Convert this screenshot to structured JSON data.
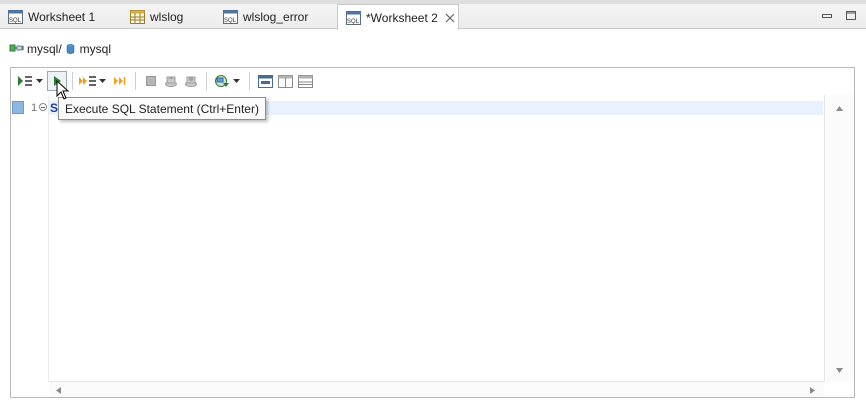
{
  "tabs": [
    {
      "label": "Worksheet 1",
      "icon": "sql-worksheet-icon",
      "active": false
    },
    {
      "label": "wlslog",
      "icon": "table-grid-icon",
      "active": false
    },
    {
      "label": "wlslog_error",
      "icon": "sql-worksheet-icon",
      "active": false
    },
    {
      "label": "*Worksheet 2",
      "icon": "sql-worksheet-icon",
      "active": true
    }
  ],
  "breadcrumb": {
    "connection": "mysql/",
    "database": "mysql"
  },
  "editor": {
    "line_number": "1",
    "code_visible": "S"
  },
  "tooltip": {
    "text": "Execute SQL Statement (Ctrl+Enter)"
  },
  "colors": {
    "accent": "#2e7d32",
    "line_highlight": "#e8f2fe",
    "gutter_marker": "#8cb7e3"
  }
}
